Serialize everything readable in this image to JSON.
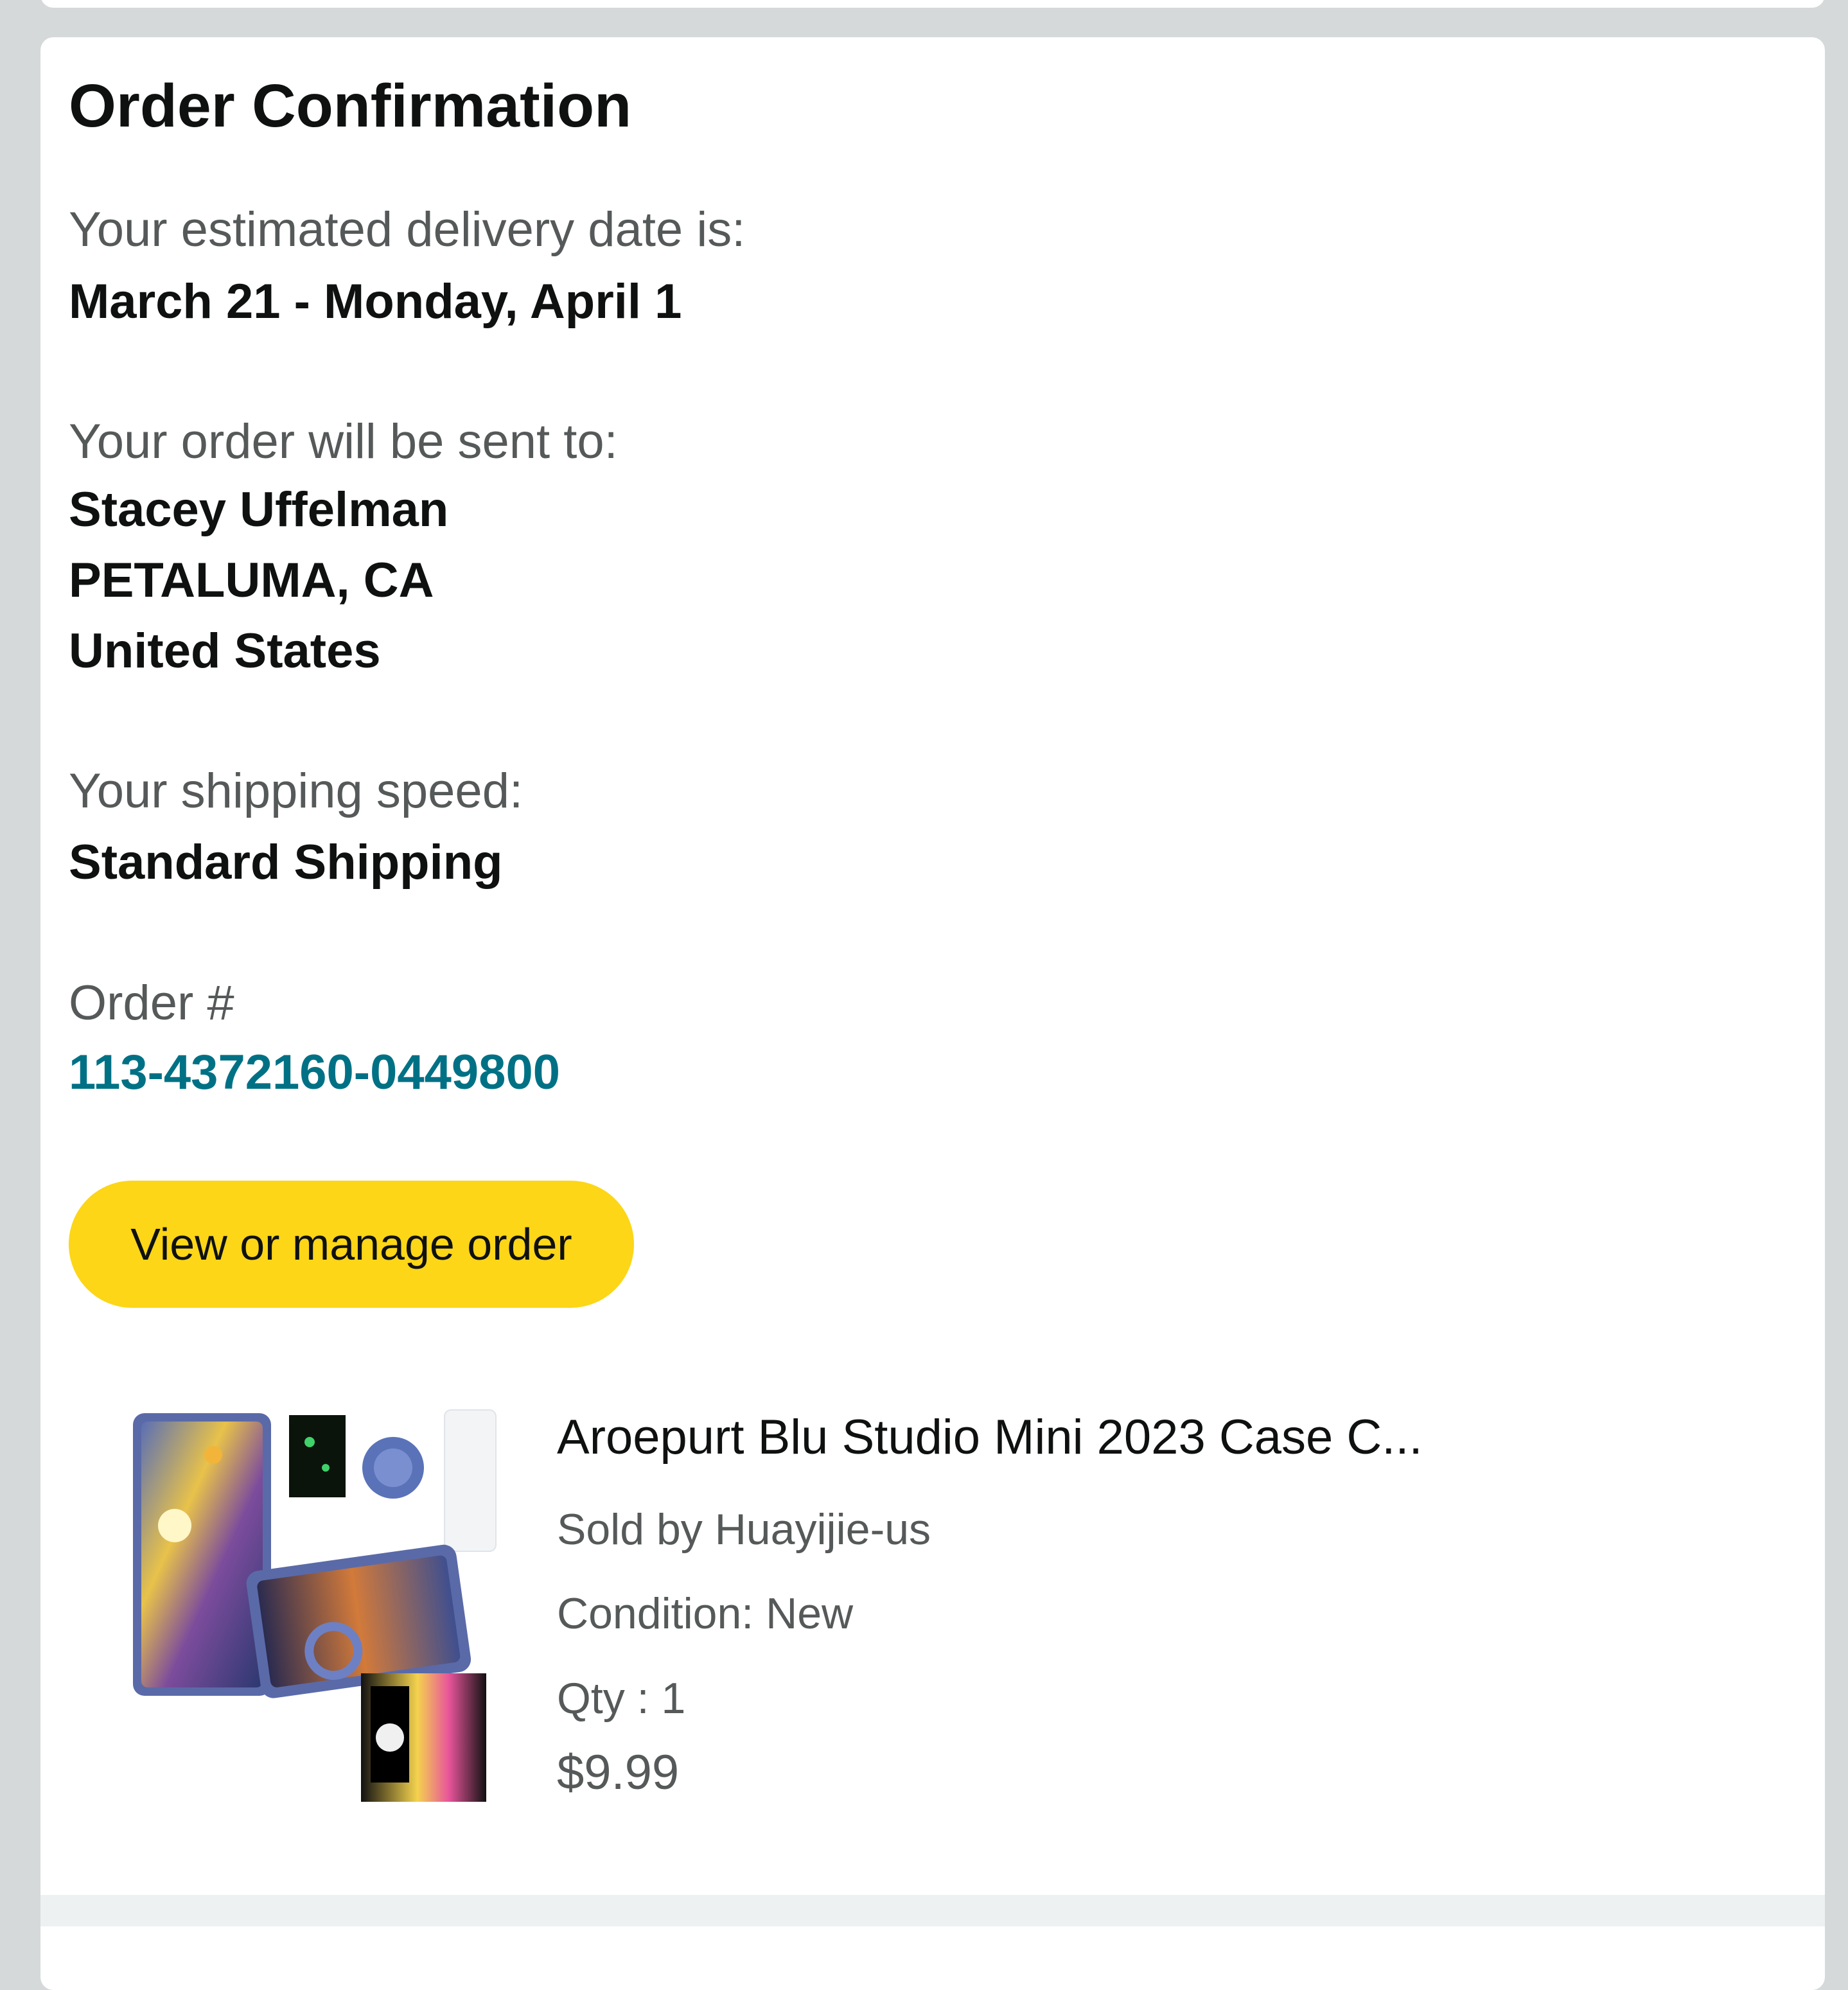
{
  "confirmation": {
    "title": "Order Confirmation",
    "delivery_label": "Your estimated delivery date is:",
    "delivery_value": "March 21 - Monday, April 1",
    "ship_to_label": "Your order will be sent to:",
    "ship_to": {
      "name": "Stacey Uffelman",
      "city_state": "PETALUMA, CA",
      "country": "United States"
    },
    "speed_label": "Your shipping speed:",
    "speed_value": "Standard Shipping",
    "order_label": "Order #",
    "order_number": "113-4372160-0449800",
    "manage_button": "View or manage order"
  },
  "product": {
    "title": "Aroepurt Blu Studio Mini 2023 Case C...",
    "seller": "Sold by Huayijie-us",
    "condition": "Condition: New",
    "qty": "Qty : 1",
    "price": "$9.99",
    "image_icon": "phone-case-product-image"
  },
  "colors": {
    "page_bg": "#d5d9d9",
    "card_bg": "#ffffff",
    "link": "#007185",
    "button": "#fcd617"
  }
}
